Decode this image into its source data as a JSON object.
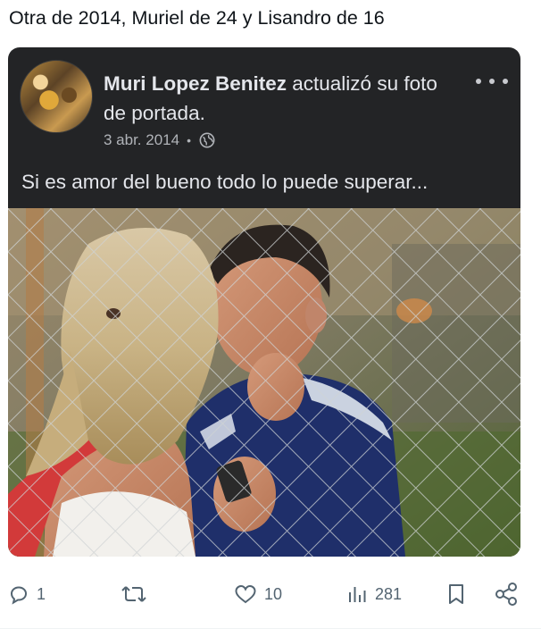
{
  "tweet": {
    "text": "Otra de 2014, Muriel de 24 y Lisandro de 16"
  },
  "facebook_post": {
    "author": "Muri Lopez Benitez",
    "action": " actualizó su foto de portada.",
    "date": "3 abr. 2014",
    "separator": "•",
    "privacy_icon": "globe-icon",
    "more_icon": "ellipsis-icon",
    "caption": "Si es amor del bueno todo lo puede superar...",
    "photo_description_icon": "photo"
  },
  "actions": {
    "replies": "1",
    "reposts": "",
    "likes": "10",
    "views": "281",
    "icons": [
      "reply-icon",
      "repost-icon",
      "like-icon",
      "views-icon",
      "bookmark-icon",
      "share-icon"
    ]
  },
  "colors": {
    "card_bg": "#232426",
    "card_text": "#e4e6eb",
    "meta_text": "#b0b3b8",
    "action_gray": "#536471",
    "tweet_text": "#0f1419"
  }
}
